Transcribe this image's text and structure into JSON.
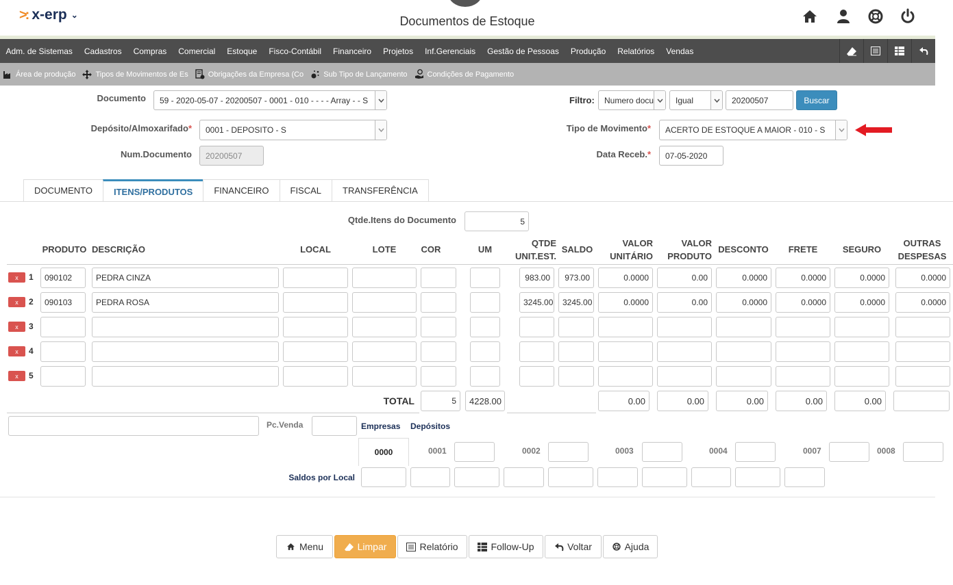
{
  "app": {
    "logo": "x-erp",
    "title": "Documentos de Estoque"
  },
  "top_icons": [
    "home-icon",
    "user-icon",
    "help-lifebuoy-icon",
    "power-icon"
  ],
  "menu": [
    "Adm. de Sistemas",
    "Cadastros",
    "Compras",
    "Comercial",
    "Estoque",
    "Fisco-Contábil",
    "Financeiro",
    "Projetos",
    "Inf.Gerenciais",
    "Gestão de Pessoas",
    "Produção",
    "Relatórios",
    "Vendas"
  ],
  "menu_tools": [
    "eraser-icon",
    "list-icon",
    "table-icon",
    "back-arrow-icon"
  ],
  "submenu": [
    {
      "label": "Área de produção",
      "icon": "factory-icon"
    },
    {
      "label": "Tipos de Movimentos de Es",
      "icon": "move-arrows-icon"
    },
    {
      "label": "Obrigações da Empresa (Co",
      "icon": "document-gear-icon"
    },
    {
      "label": "Sub Tipo de Lançamento",
      "icon": "sparkle-icon"
    },
    {
      "label": "Condições de Pagamento",
      "icon": "hand-money-icon"
    }
  ],
  "form": {
    "documento_label": "Documento",
    "documento_value": "59 - 2020-05-07 - 20200507 - 0001 - 010 - - - - Array - - S",
    "deposito_label": "Depósito/Almoxarifado",
    "deposito_value": "0001 - DEPOSITO - S",
    "numdoc_label": "Num.Documento",
    "numdoc_value": "20200507",
    "filtro_label": "Filtro:",
    "filtro_campo": "Numero documento",
    "filtro_op": "Igual",
    "filtro_valor": "20200507",
    "buscar": "Buscar",
    "tipomov_label": "Tipo de Movimento",
    "tipomov_value": "ACERTO DE ESTOQUE A MAIOR - 010 - S",
    "datareceb_label": "Data Receb.",
    "datareceb_value": "07-05-2020",
    "required_mark": "*",
    "arrow_color": "#e31b23"
  },
  "tabs": [
    {
      "label": "DOCUMENTO",
      "active": false
    },
    {
      "label": "ITENS/PRODUTOS",
      "active": true
    },
    {
      "label": "FINANCEIRO",
      "active": false
    },
    {
      "label": "FISCAL",
      "active": false
    },
    {
      "label": "TRANSFERÊNCIA",
      "active": false
    }
  ],
  "qtde": {
    "label": "Qtde.Itens do Documento",
    "value": "5"
  },
  "table": {
    "headers": {
      "produto": "PRODUTO",
      "descricao": "DESCRIÇÃO",
      "local": "LOCAL",
      "lote": "LOTE",
      "cor": "COR",
      "um": "UM",
      "qtde1": "QTDE",
      "qtde2": "UNIT.EST.",
      "saldo": "SALDO",
      "vunit1": "VALOR",
      "vunit2": "UNITÁRIO",
      "vprod1": "VALOR",
      "vprod2": "PRODUTO",
      "desconto": "DESCONTO",
      "frete": "FRETE",
      "seguro": "SEGURO",
      "outras1": "OUTRAS",
      "outras2": "DESPESAS"
    },
    "delete_label": "x",
    "rows": [
      {
        "n": "1",
        "produto": "090102",
        "descricao": "PEDRA CINZA",
        "local": "",
        "lote": "",
        "cor": "",
        "um": "",
        "qtde": "983.00",
        "saldo": "973.00",
        "vunit": "0.0000",
        "vprod": "0.00",
        "desconto": "0.0000",
        "frete": "0.0000",
        "seguro": "0.0000",
        "outras": "0.0000"
      },
      {
        "n": "2",
        "produto": "090103",
        "descricao": "PEDRA ROSA",
        "local": "",
        "lote": "",
        "cor": "",
        "um": "",
        "qtde": "3245.00",
        "saldo": "3245.00",
        "vunit": "0.0000",
        "vprod": "0.00",
        "desconto": "0.0000",
        "frete": "0.0000",
        "seguro": "0.0000",
        "outras": "0.0000"
      },
      {
        "n": "3",
        "produto": "",
        "descricao": "",
        "local": "",
        "lote": "",
        "cor": "",
        "um": "",
        "qtde": "",
        "saldo": "",
        "vunit": "",
        "vprod": "",
        "desconto": "",
        "frete": "",
        "seguro": "",
        "outras": ""
      },
      {
        "n": "4",
        "produto": "",
        "descricao": "",
        "local": "",
        "lote": "",
        "cor": "",
        "um": "",
        "qtde": "",
        "saldo": "",
        "vunit": "",
        "vprod": "",
        "desconto": "",
        "frete": "",
        "seguro": "",
        "outras": ""
      },
      {
        "n": "5",
        "produto": "",
        "descricao": "",
        "local": "",
        "lote": "",
        "cor": "",
        "um": "",
        "qtde": "",
        "saldo": "",
        "vunit": "",
        "vprod": "",
        "desconto": "",
        "frete": "",
        "seguro": "",
        "outras": ""
      }
    ],
    "total_label": "TOTAL",
    "totals": {
      "count": "5",
      "qtde": "4228.00",
      "vunit": "0.00",
      "vprod": "0.00",
      "desconto": "0.00",
      "frete": "0.00",
      "seguro": "0.00",
      "outras": ""
    }
  },
  "bottom": {
    "pcvenda_label": "Pc.Venda",
    "empresas": "Empresas",
    "depositos": "Depósitos",
    "emp_selected": "0000",
    "emp_codes": [
      "0001",
      "0002",
      "0003",
      "0004",
      "0007",
      "0008"
    ],
    "saldos_label": "Saldos por Local"
  },
  "buttons": [
    {
      "label": "Menu",
      "icon": "home-icon"
    },
    {
      "label": "Limpar",
      "icon": "eraser-icon"
    },
    {
      "label": "Relatório",
      "icon": "list-icon"
    },
    {
      "label": "Follow-Up",
      "icon": "table-icon"
    },
    {
      "label": "Voltar",
      "icon": "back-arrow-icon"
    },
    {
      "label": "Ajuda",
      "icon": "help-lifebuoy-icon"
    }
  ]
}
